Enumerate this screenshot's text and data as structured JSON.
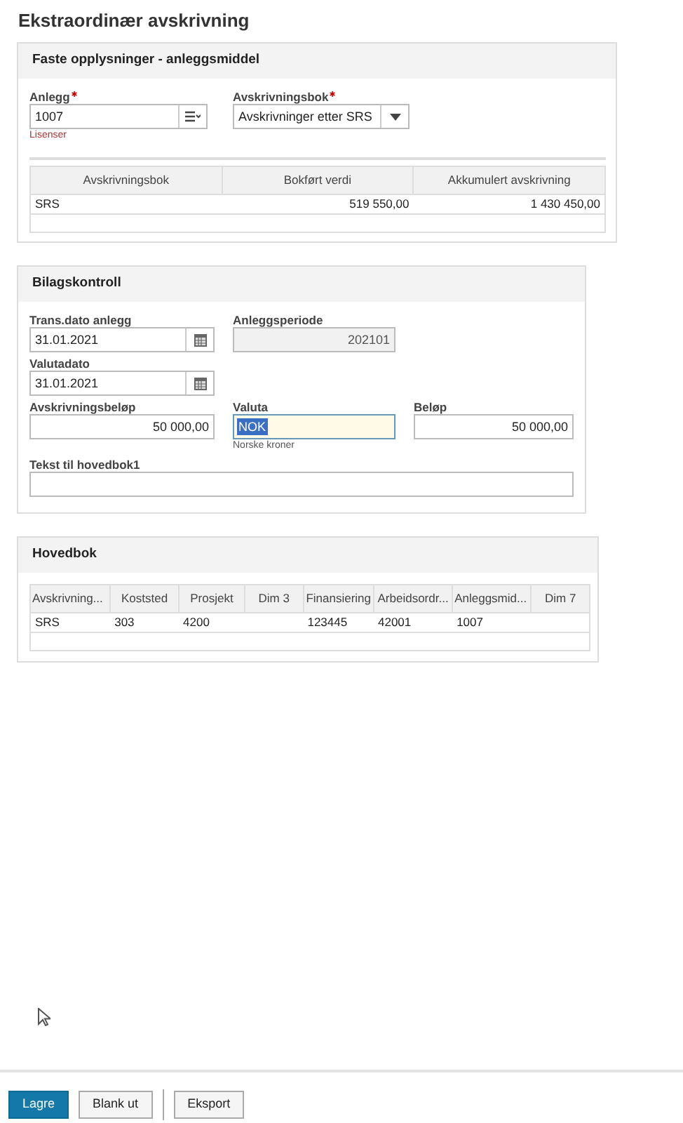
{
  "title": "Ekstraordinær avskrivning",
  "fixed_info": {
    "title": "Faste opplysninger - anleggsmiddel",
    "fields": [
      {
        "label": "Anlegg",
        "required": true,
        "value": "1007",
        "kind": "lookup",
        "hint": "Lisenser"
      },
      {
        "label": "Avskrivningsbok",
        "required": true,
        "value": "Avskrivninger etter SRS",
        "kind": "select"
      }
    ],
    "table": {
      "columns": [
        "Avskrivningsbok",
        "Bokført verdi",
        "Akkumulert avskrivning"
      ],
      "rows": [
        [
          "SRS",
          "519 550,00",
          "1 430 450,00"
        ]
      ]
    }
  },
  "voucher": {
    "title": "Bilagskontroll",
    "rows": [
      [
        {
          "label": "Trans.dato anlegg",
          "value": "31.01.2021",
          "kind": "date"
        },
        {
          "label": "Anleggsperiode",
          "value": "202101",
          "kind": "readonly"
        }
      ],
      [
        {
          "label": "Valutadato",
          "value": "31.01.2021",
          "kind": "date"
        }
      ],
      [
        {
          "label": "Avskrivningsbeløp",
          "value": "50 000,00",
          "kind": "amount"
        },
        {
          "label": "Valuta",
          "value": "NOK",
          "kind": "text",
          "focused": true,
          "hint": "Norske kroner"
        },
        {
          "label": "Beløp",
          "value": "50 000,00",
          "kind": "amount"
        }
      ],
      [
        {
          "label": "Tekst til hovedbok1",
          "kind": "wide"
        }
      ]
    ]
  },
  "ledger": {
    "title": "Hovedbok",
    "columns": [
      "Avskrivning...",
      "Koststed",
      "Prosjekt",
      "Dim 3",
      "Finansiering",
      "Arbeidsordr...",
      "Anleggsmid...",
      "Dim 7"
    ],
    "rows": [
      [
        "SRS",
        "303",
        "4200",
        "",
        "123445",
        "42001",
        "1007",
        ""
      ]
    ]
  },
  "buttons": [
    {
      "label": "Lagre",
      "kind": "primary",
      "separated_before": false
    },
    {
      "label": "Blank ut",
      "kind": "default",
      "separated_before": false
    },
    {
      "label": "Eksport",
      "kind": "default",
      "separated_before": true
    }
  ]
}
